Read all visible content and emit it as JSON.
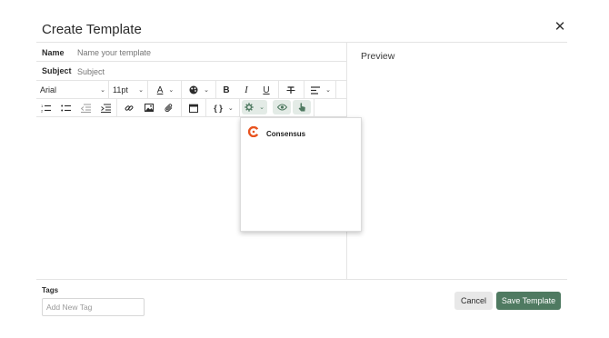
{
  "dialog": {
    "title": "Create Template",
    "close_icon": "close-icon",
    "close_glyph": "✕"
  },
  "form": {
    "name_label": "Name",
    "name_placeholder": "Name your template",
    "subject_label": "Subject",
    "subject_placeholder": "Subject"
  },
  "preview": {
    "label": "Preview"
  },
  "toolbar": {
    "font_family": "Arial",
    "font_size": "11pt",
    "text_color_glyph": "A",
    "bold_glyph": "B",
    "italic_glyph": "I",
    "underline_glyph": "U",
    "variables_glyph": "{ }",
    "chevron": "⌄",
    "icons": [
      "text-color-icon",
      "palette-icon",
      "bold-icon",
      "italic-icon",
      "underline-icon",
      "strikethrough-icon",
      "align-icon",
      "ordered-list-icon",
      "bullet-list-icon",
      "outdent-icon",
      "indent-icon",
      "link-icon",
      "image-icon",
      "attachment-icon",
      "calendar-icon",
      "variables-icon",
      "integrations-icon",
      "eye-icon",
      "hand-pointer-icon"
    ]
  },
  "integrations_menu": {
    "items": [
      {
        "label": "Consensus",
        "icon": "consensus-logo"
      }
    ]
  },
  "tags": {
    "label": "Tags",
    "placeholder": "Add New Tag"
  },
  "actions": {
    "cancel_label": "Cancel",
    "save_label": "Save Template"
  },
  "colors": {
    "primary": "#4f7a61",
    "highlight": "#e3ebe6",
    "divider": "#e4e4e4",
    "consensus_orange": "#e8531f"
  }
}
